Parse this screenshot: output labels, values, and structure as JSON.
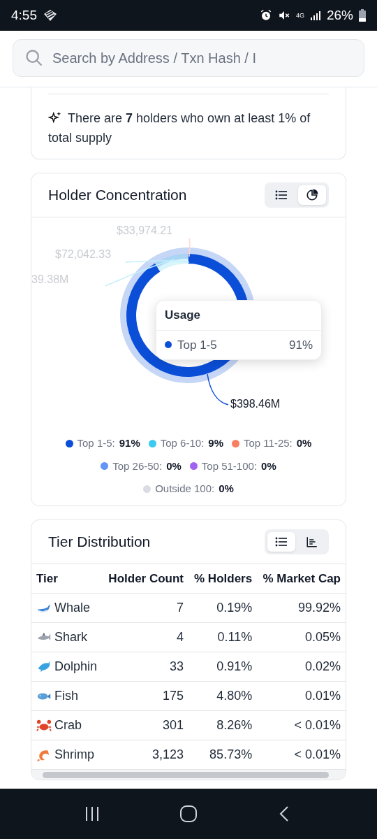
{
  "status_bar": {
    "time": "4:55",
    "network": "4G",
    "battery": "26%"
  },
  "search": {
    "placeholder": "Search by Address / Txn Hash / I"
  },
  "summary": {
    "text": "There are **7** holders who own at least 1% of total supply"
  },
  "holder_concentration": {
    "title": "Holder Concentration",
    "views": [
      {
        "selected": false
      },
      {
        "selected": true
      }
    ],
    "chart_data": {
      "type": "donut",
      "series": [
        {
          "name": "Usage",
          "values": [
            91,
            9,
            0,
            0,
            0,
            0
          ]
        }
      ]
    },
    "slice_labels": [
      {
        "text": "$33,974.21",
        "color": "#fdd8cf"
      },
      {
        "text": "$72,042.33",
        "color": "#c4f0fb"
      },
      {
        "text": "39.38M",
        "color": "#c4f0fb"
      },
      {
        "text": "$398.46M",
        "color": "#0b4fd9"
      }
    ],
    "tooltip": {
      "label": "Top 1-5",
      "value": "91%",
      "color": "#0b4fd9"
    },
    "legend": [
      {
        "label": "Top 1-5:",
        "value": "91%",
        "color": "#0b4fd9"
      },
      {
        "label": "Top 6-10:",
        "value": "9%",
        "color": "#3ccbf0"
      },
      {
        "label": "Top 11-25:",
        "value": "0%",
        "color": "#f87f62"
      },
      {
        "label": "Top 26-50:",
        "value": "0%",
        "color": "#6295f5"
      },
      {
        "label": "Top 51-100:",
        "value": "0%",
        "color": "#a263f0"
      },
      {
        "label": "Outside 100:",
        "value": "0%",
        "color": "#d9dde3"
      }
    ]
  },
  "tier_distribution": {
    "title": "Tier Distribution",
    "views": [
      {
        "selected": true
      },
      {
        "selected": false
      }
    ],
    "columns": [
      "Tier",
      "Holder Count",
      "% Holders",
      "% Market Cap"
    ],
    "rows": [
      [
        "Whale",
        "7",
        "0.19%",
        "99.92%"
      ],
      [
        "Shark",
        "4",
        "0.11%",
        "0.05%"
      ],
      [
        "Dolphin",
        "33",
        "0.91%",
        "0.02%"
      ],
      [
        "Fish",
        "175",
        "4.80%",
        "0.01%"
      ],
      [
        "Crab",
        "301",
        "8.26%",
        "< 0.01%"
      ],
      [
        "Shrimp",
        "3,123",
        "85.73%",
        "< 0.01%"
      ]
    ]
  }
}
